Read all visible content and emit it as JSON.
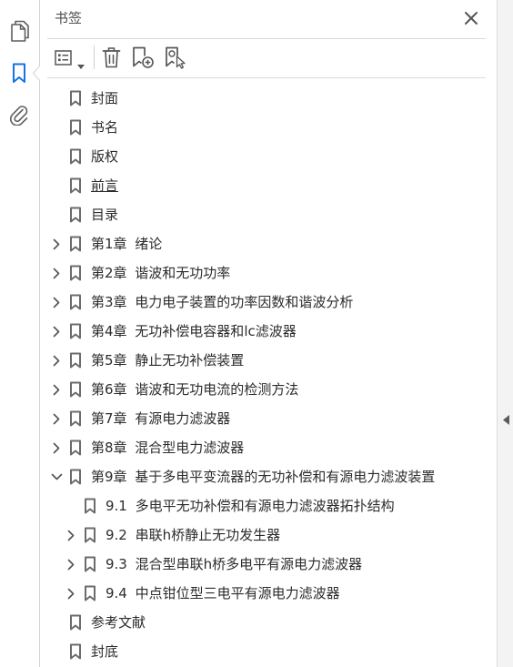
{
  "rail": {
    "pages_icon": "pages-icon",
    "bookmarks_icon": "bookmark-icon",
    "attachments_icon": "paperclip-icon",
    "bookmarks_active": true
  },
  "panel": {
    "title": "书签",
    "close_icon": "close-icon"
  },
  "toolbar": {
    "icons": [
      "list-options-icon",
      "dropdown-caret-icon",
      "trash-icon",
      "add-bookmark-icon",
      "bookmark-search-icon"
    ]
  },
  "side_handle": {
    "icon": "collapse-left-icon"
  },
  "bookmarks": [
    {
      "label": "封面",
      "level": 0,
      "expandable": false,
      "expanded": false
    },
    {
      "label": "书名",
      "level": 0,
      "expandable": false,
      "expanded": false
    },
    {
      "label": "版权",
      "level": 0,
      "expandable": false,
      "expanded": false
    },
    {
      "label": "前言",
      "level": 0,
      "expandable": false,
      "expanded": false,
      "hovered": true
    },
    {
      "label": "目录",
      "level": 0,
      "expandable": false,
      "expanded": false
    },
    {
      "label": "第1章 绪论",
      "level": 0,
      "expandable": true,
      "expanded": false
    },
    {
      "label": "第2章 谐波和无功功率",
      "level": 0,
      "expandable": true,
      "expanded": false
    },
    {
      "label": "第3章 电力电子装置的功率因数和谐波分析",
      "level": 0,
      "expandable": true,
      "expanded": false
    },
    {
      "label": "第4章 无功补偿电容器和lc滤波器",
      "level": 0,
      "expandable": true,
      "expanded": false
    },
    {
      "label": "第5章 静止无功补偿装置",
      "level": 0,
      "expandable": true,
      "expanded": false
    },
    {
      "label": "第6章 谐波和无功电流的检测方法",
      "level": 0,
      "expandable": true,
      "expanded": false
    },
    {
      "label": "第7章 有源电力滤波器",
      "level": 0,
      "expandable": true,
      "expanded": false
    },
    {
      "label": "第8章 混合型电力滤波器",
      "level": 0,
      "expandable": true,
      "expanded": false
    },
    {
      "label": "第9章 基于多电平变流器的无功补偿和有源电力滤波装置",
      "level": 0,
      "expandable": true,
      "expanded": true
    },
    {
      "label": "9.1 多电平无功补偿和有源电力滤波器拓扑结构",
      "level": 1,
      "expandable": false,
      "expanded": false
    },
    {
      "label": "9.2 串联h桥静止无功发生器",
      "level": 1,
      "expandable": true,
      "expanded": false
    },
    {
      "label": "9.3 混合型串联h桥多电平有源电力滤波器",
      "level": 1,
      "expandable": true,
      "expanded": false
    },
    {
      "label": "9.4 中点钳位型三电平有源电力滤波器",
      "level": 1,
      "expandable": true,
      "expanded": false
    },
    {
      "label": "参考文献",
      "level": 0,
      "expandable": false,
      "expanded": false
    },
    {
      "label": "封底",
      "level": 0,
      "expandable": false,
      "expanded": false
    }
  ],
  "colors": {
    "accent": "#1473e6",
    "text": "#2c2c2c",
    "icon": "#6b6b6b",
    "divider": "#d9d9d9"
  }
}
